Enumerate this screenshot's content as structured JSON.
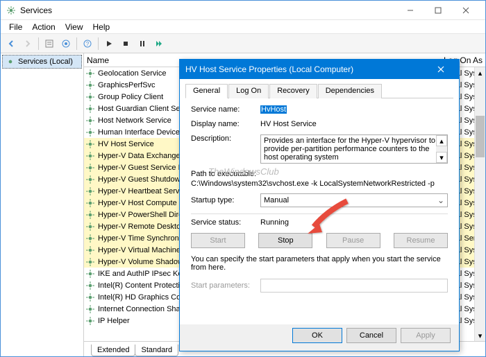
{
  "window": {
    "title": "Services",
    "menu": {
      "file": "File",
      "action": "Action",
      "view": "View",
      "help": "Help"
    }
  },
  "tree": {
    "root": "Services (Local)"
  },
  "columns": {
    "name": "Name",
    "logon": "Log On As"
  },
  "services": [
    {
      "name": "Geolocation Service",
      "hl": false
    },
    {
      "name": "GraphicsPerfSvc",
      "hl": false
    },
    {
      "name": "Group Policy Client",
      "hl": false
    },
    {
      "name": "Host Guardian Client Service",
      "hl": false
    },
    {
      "name": "Host Network Service",
      "hl": false
    },
    {
      "name": "Human Interface Device Service",
      "hl": false
    },
    {
      "name": "HV Host Service",
      "hl": true
    },
    {
      "name": "Hyper-V Data Exchange Service",
      "hl": true
    },
    {
      "name": "Hyper-V Guest Service Interface",
      "hl": true
    },
    {
      "name": "Hyper-V Guest Shutdown Service",
      "hl": true
    },
    {
      "name": "Hyper-V Heartbeat Service",
      "hl": true
    },
    {
      "name": "Hyper-V Host Compute Service",
      "hl": true
    },
    {
      "name": "Hyper-V PowerShell Direct Service",
      "hl": true
    },
    {
      "name": "Hyper-V Remote Desktop Virtualization",
      "hl": true
    },
    {
      "name": "Hyper-V Time Synchronization Service",
      "hl": true
    },
    {
      "name": "Hyper-V Virtual Machine Management",
      "hl": true
    },
    {
      "name": "Hyper-V Volume Shadow Copy Requestor",
      "hl": true
    },
    {
      "name": "IKE and AuthIP IPsec Keying Modules",
      "hl": false
    },
    {
      "name": "Intel(R) Content Protection HECI",
      "hl": false
    },
    {
      "name": "Intel(R) HD Graphics Control Panel",
      "hl": false
    },
    {
      "name": "Internet Connection Sharing (ICS)",
      "hl": false
    },
    {
      "name": "IP Helper",
      "hl": false
    }
  ],
  "logon_values": [
    "Local Syste...",
    "Local Syste...",
    "Local Syste...",
    "Local Syste...",
    "Local Syste...",
    "Local Syste...",
    "Local Syste...",
    "Local Syste...",
    "Local Syste...",
    "Local Syste...",
    "Local Syste...",
    "Local Syste...",
    "Local Syste...",
    "Local Syste...",
    "Local Service",
    "Local Syste...",
    "Local Syste...",
    "Local Syste...",
    "Local Syste...",
    "Local Syste...",
    "Local Syste...",
    "Local Syste..."
  ],
  "bottom_tabs": {
    "extended": "Extended",
    "standard": "Standard"
  },
  "dialog": {
    "title": "HV Host Service Properties (Local Computer)",
    "tabs": {
      "general": "General",
      "logon": "Log On",
      "recovery": "Recovery",
      "deps": "Dependencies"
    },
    "labels": {
      "service_name": "Service name:",
      "display_name": "Display name:",
      "description": "Description:",
      "path": "Path to executable:",
      "startup": "Startup type:",
      "status": "Service status:",
      "params": "Start parameters:"
    },
    "values": {
      "service_name": "HvHost",
      "display_name": "HV Host Service",
      "description": "Provides an interface for the Hyper-V hypervisor to provide per-partition performance counters to the host operating system",
      "path": "C:\\Windows\\system32\\svchost.exe -k LocalSystemNetworkRestricted -p",
      "startup": "Manual",
      "status": "Running",
      "note": "You can specify the start parameters that apply when you start the service from here."
    },
    "buttons": {
      "start": "Start",
      "stop": "Stop",
      "pause": "Pause",
      "resume": "Resume",
      "ok": "OK",
      "cancel": "Cancel",
      "apply": "Apply"
    }
  },
  "watermark": "TheWindowsClub"
}
